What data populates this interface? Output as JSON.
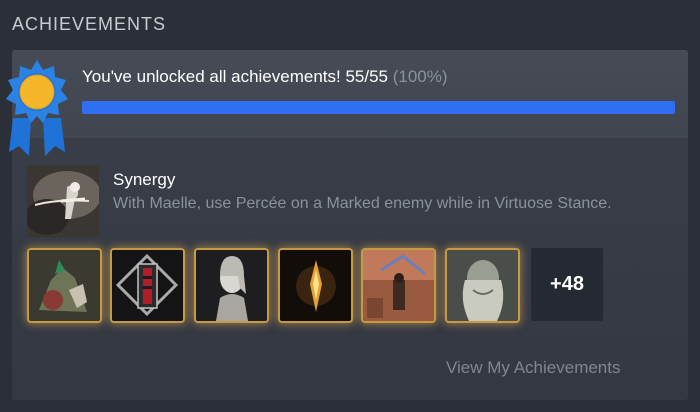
{
  "section": {
    "title": "ACHIEVEMENTS"
  },
  "summary": {
    "message": "You've unlocked all achievements! 55/55",
    "percent_text": "(100%)",
    "progress_fraction": 1.0,
    "medal_icon": "award-ribbon-icon"
  },
  "featured": {
    "name": "Synergy",
    "description": "With Maelle, use Percée on a Marked enemy while in Virtuose Stance."
  },
  "thumbnails_more": "+48",
  "footer": {
    "link": "View My Achievements"
  },
  "colors": {
    "background": "#2b2f38",
    "panel": "#3a3f49",
    "progress": "#2f6ff0",
    "gold_glow": "#c69a45",
    "medal_blue": "#2a82e4",
    "medal_gold": "#f5b62a"
  }
}
